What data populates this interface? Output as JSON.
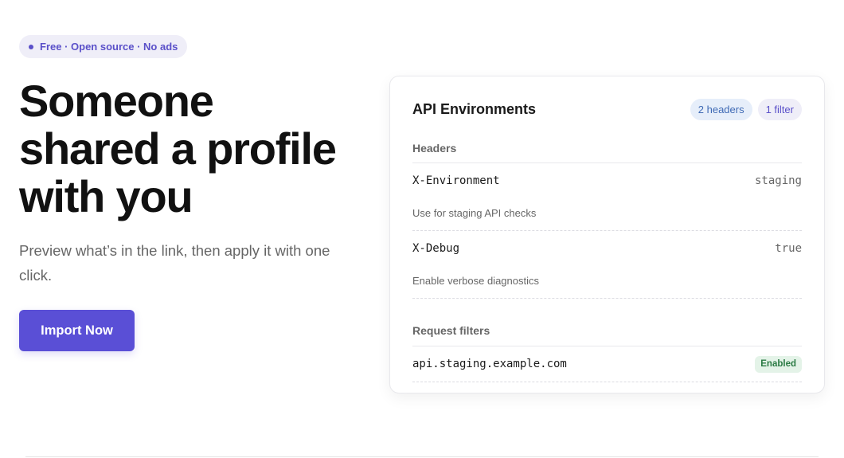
{
  "hero": {
    "badge": "Free · Open source · No ads",
    "headline": "Someone shared a profile with you",
    "subtitle": "Preview what’s in the link, then apply it with one click.",
    "cta_label": "Import Now"
  },
  "card": {
    "title": "API Environments",
    "headers_pill": "2 headers",
    "filter_pill": "1 filter",
    "headers_label": "Headers",
    "headers": [
      {
        "key": "X-Environment",
        "value": "staging",
        "description": "Use for staging API checks"
      },
      {
        "key": "X-Debug",
        "value": "true",
        "description": "Enable verbose diagnostics"
      }
    ],
    "filters_label": "Request filters",
    "filters": [
      {
        "value": "api.staging.example.com",
        "status": "Enabled"
      }
    ]
  },
  "colors": {
    "accent": "#5a4fd6",
    "badge_text": "#5a50c9",
    "enabled_green": "#2a7a43"
  }
}
